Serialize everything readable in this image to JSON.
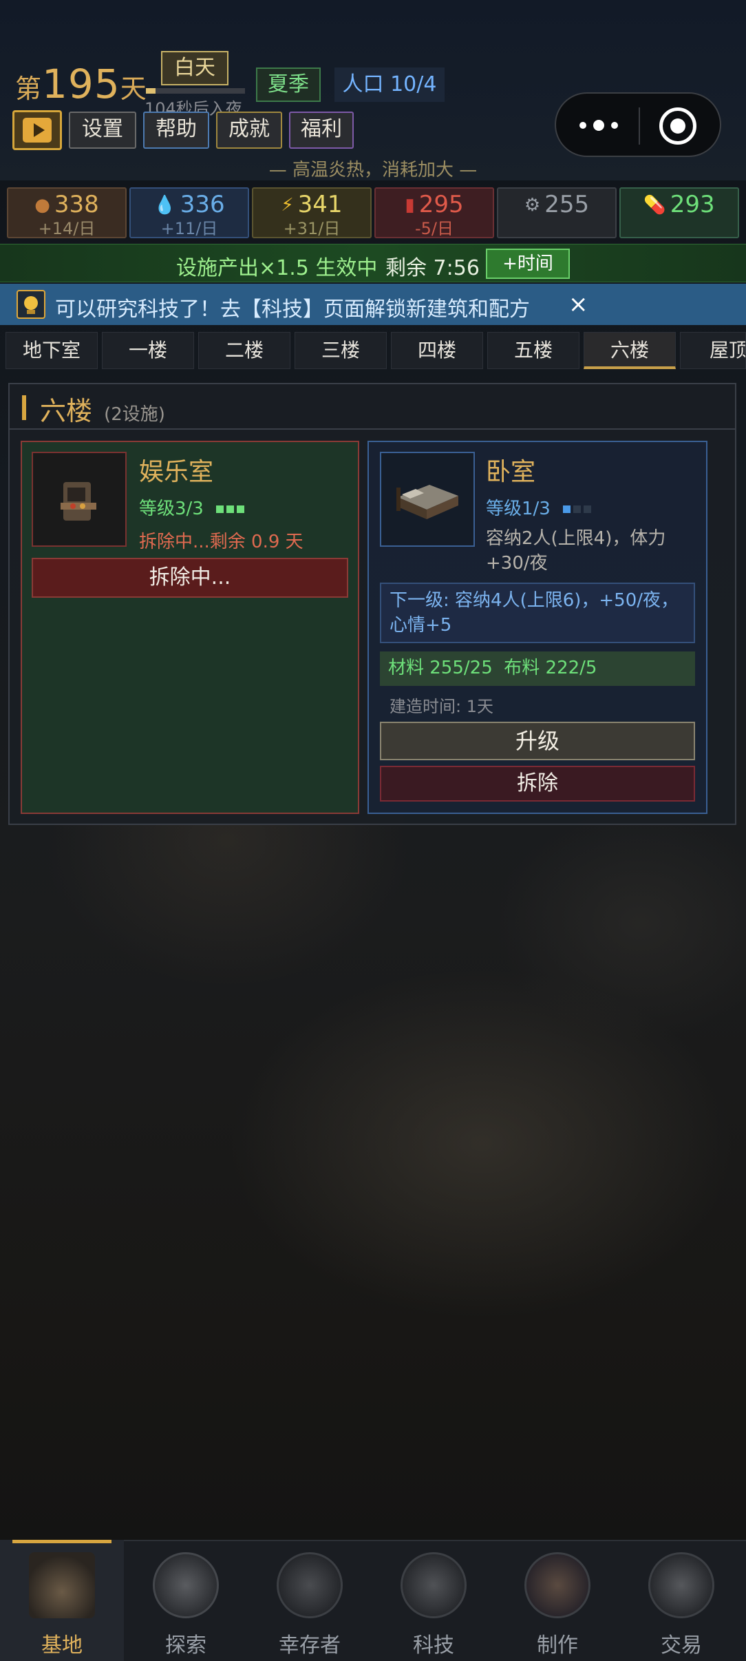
{
  "header": {
    "day_prefix": "第",
    "day_number": "195",
    "day_suffix": "天",
    "phase": "白天",
    "night_countdown": "104秒后入夜",
    "night_progress": 0.1,
    "season": "夏季",
    "population": "人口 10/4",
    "notice": "— 高温炎热，消耗加大 —"
  },
  "toolbar": {
    "settings": "设置",
    "help": "帮助",
    "achievements": "成就",
    "welfare": "福利"
  },
  "resources": [
    {
      "value": "338",
      "rate": "+14/日",
      "icon": "food-icon",
      "color": "#e0b25c"
    },
    {
      "value": "336",
      "rate": "+11/日",
      "icon": "water-icon",
      "color": "#6aaee8"
    },
    {
      "value": "341",
      "rate": "+31/日",
      "icon": "energy-icon",
      "color": "#e8d66a"
    },
    {
      "value": "295",
      "rate": "-5/日",
      "icon": "fuel-icon",
      "color": "#e05a4a"
    },
    {
      "value": "255",
      "rate": "",
      "icon": "gear-icon",
      "color": "#9aa0a8"
    },
    {
      "value": "293",
      "rate": "",
      "icon": "medicine-icon",
      "color": "#6ee07a"
    }
  ],
  "boost": {
    "text": "设施产出×1.5 生效中",
    "remaining": "剩余 7:56",
    "button": "+时间"
  },
  "tip": {
    "text": "可以研究科技了！去【科技】页面解锁新建筑和配方",
    "close": "×"
  },
  "floor_tabs": [
    "地下室",
    "一楼",
    "二楼",
    "三楼",
    "四楼",
    "五楼",
    "六楼",
    "屋顶"
  ],
  "active_floor_index": 6,
  "floor": {
    "name": "六楼",
    "count": "(2设施)"
  },
  "facilities": [
    {
      "name": "娱乐室",
      "level": "等级3/3",
      "level_fill": 3,
      "level_max": 3,
      "status": "拆除中...剩余 0.9 天",
      "action": "拆除中..."
    },
    {
      "name": "卧室",
      "level": "等级1/3",
      "level_fill": 1,
      "level_max": 3,
      "desc": "容纳2人(上限4)，体力+30/夜",
      "next": "下一级: 容纳4人(上限6)，+50/夜，心情+5",
      "materials": "材料 255/25  布料 222/5",
      "build_time": "建造时间: 1天",
      "upgrade": "升级",
      "demolish": "拆除"
    }
  ],
  "nav": [
    {
      "label": "基地",
      "icon": "base-icon",
      "active": true
    },
    {
      "label": "探索",
      "icon": "explore-icon",
      "active": false
    },
    {
      "label": "幸存者",
      "icon": "survivors-icon",
      "active": false
    },
    {
      "label": "科技",
      "icon": "tech-icon",
      "active": false
    },
    {
      "label": "制作",
      "icon": "craft-icon",
      "active": false
    },
    {
      "label": "交易",
      "icon": "trade-icon",
      "active": false
    }
  ],
  "capsule": {
    "more": "•••",
    "target": "◉"
  }
}
